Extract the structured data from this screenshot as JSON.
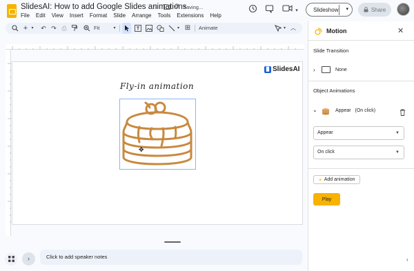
{
  "app": {
    "title": "SlidesAI: How to add Google Slides animations",
    "saving": "Saving...",
    "menu": [
      "File",
      "Edit",
      "View",
      "Insert",
      "Format",
      "Slide",
      "Arrange",
      "Tools",
      "Extensions",
      "Help"
    ]
  },
  "header": {
    "slideshow_label": "Slideshow",
    "share_label": "Share"
  },
  "toolbar": {
    "zoom": "Fit",
    "animate_label": "Animate"
  },
  "slide": {
    "brand": "SlidesAI",
    "heading": "Fly-in animation"
  },
  "notes": {
    "placeholder": "Click to add speaker notes"
  },
  "motion_panel": {
    "title": "Motion",
    "slide_transition_label": "Slide Transition",
    "transition_value": "None",
    "object_animations_label": "Object Animations",
    "animation_summary_type": "Appear",
    "animation_summary_trigger": "(On click)",
    "animation_type": "Appear",
    "animation_trigger": "On click",
    "add_animation_label": "Add animation",
    "play_label": "Play"
  },
  "colors": {
    "accent": "#f8b200",
    "pancake": "#c8893e",
    "selection": "#8ab4f8"
  }
}
